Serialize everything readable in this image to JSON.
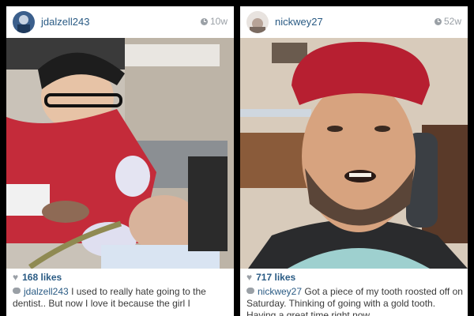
{
  "posts": [
    {
      "username": "jdalzell243",
      "time": "10w",
      "likes": "168 likes",
      "caption_user": "jdalzell243",
      "caption_text": "I used to really hate going to the dentist.. But now I love it because the girl I"
    },
    {
      "username": "nickwey27",
      "time": "52w",
      "likes": "717 likes",
      "caption_user": "nickwey27",
      "caption_text": "Got a piece of my tooth roosted off on Saturday. Thinking of going with a gold tooth. Having a great time right now"
    }
  ],
  "icons": {
    "time": "clock-icon",
    "likes": "heart-icon",
    "comment": "comment-bubble-icon"
  },
  "colors": {
    "username": "#2a5b84",
    "meta": "#9aa0a6",
    "background": "#000000"
  }
}
